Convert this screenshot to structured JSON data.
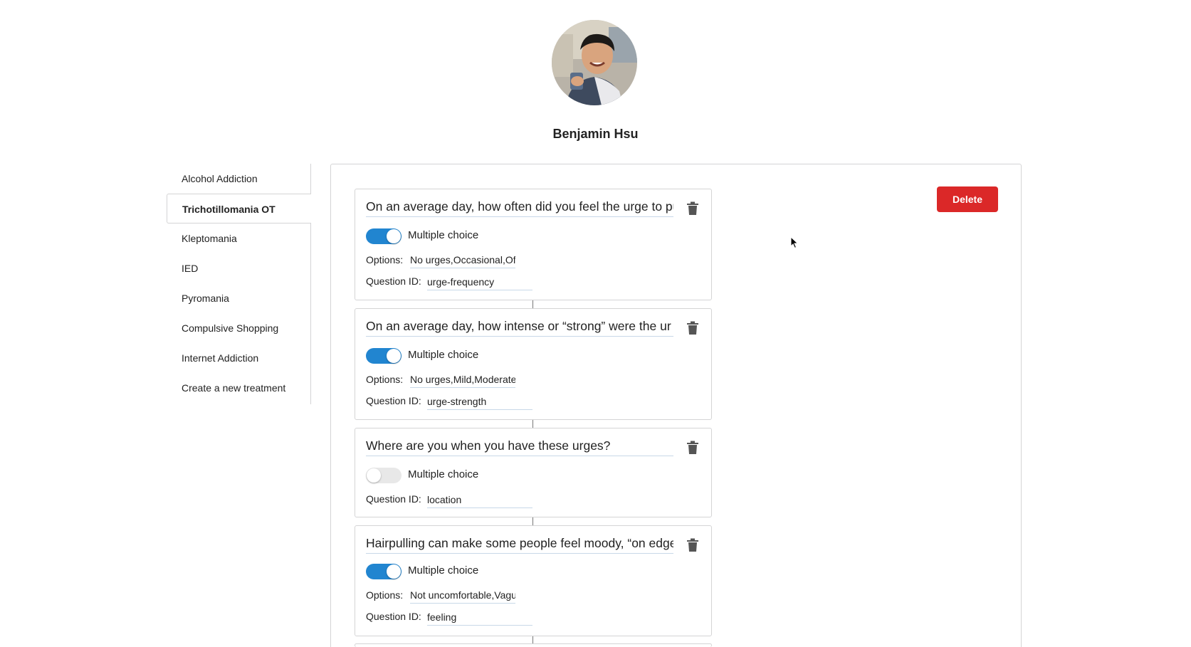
{
  "profile": {
    "name": "Benjamin Hsu",
    "avatar_icon": "user-photo"
  },
  "sidebar": {
    "items": [
      {
        "label": "Alcohol Addiction",
        "active": false
      },
      {
        "label": "Trichotillomania OT",
        "active": true
      },
      {
        "label": "Kleptomania",
        "active": false
      },
      {
        "label": "IED",
        "active": false
      },
      {
        "label": "Pyromania",
        "active": false
      },
      {
        "label": "Compulsive Shopping",
        "active": false
      },
      {
        "label": "Internet Addiction",
        "active": false
      },
      {
        "label": "Create a new treatment",
        "active": false
      }
    ]
  },
  "actions": {
    "delete_label": "Delete"
  },
  "labels": {
    "multiple_choice": "Multiple choice",
    "options": "Options:",
    "question_id": "Question ID:"
  },
  "questions": [
    {
      "text": "On an average day, how often  did you feel the urge to pu",
      "multiple_choice": true,
      "options": "No urges,Occasional,Oft",
      "question_id": "urge-frequency"
    },
    {
      "text": "On an average day, how intense  or “strong” were the ur",
      "multiple_choice": true,
      "options": "No urges,Mild,Moderate",
      "question_id": "urge-strength"
    },
    {
      "text": "Where are you when you have these urges?",
      "multiple_choice": false,
      "options": "",
      "question_id": "location"
    },
    {
      "text": "Hairpulling can make some  people feel moody, “on edge",
      "multiple_choice": true,
      "options": "Not uncomfortable,Vagu",
      "question_id": "feeling"
    }
  ],
  "colors": {
    "accent": "#2185d0",
    "danger": "#db2828",
    "border": "#d4d4d5"
  }
}
